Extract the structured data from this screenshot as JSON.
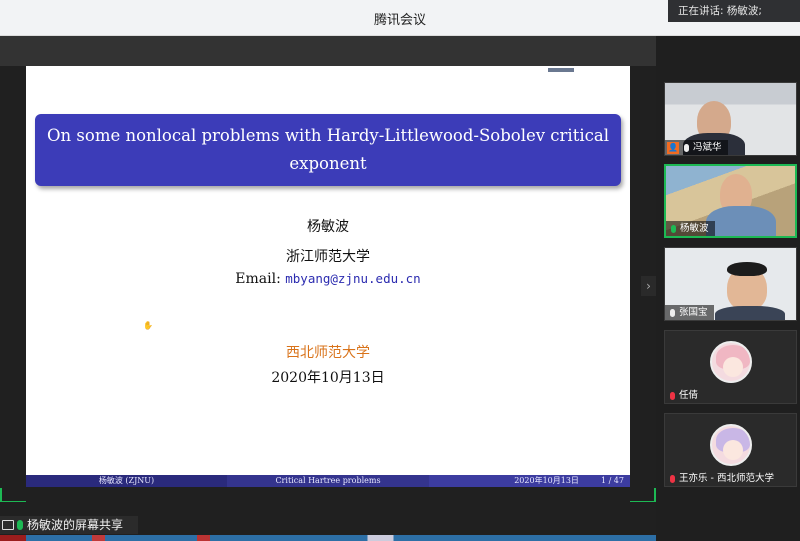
{
  "app": {
    "title": "腾讯会议",
    "speaking": "正在讲话: 杨敏波;"
  },
  "slide": {
    "title": "On some nonlocal problems with Hardy-Littlewood-Sobolev critical exponent",
    "author": "杨敏波",
    "affiliation": "浙江师范大学",
    "email_label": "Email: ",
    "email": "mbyang@zjnu.edu.cn",
    "host": "西北师范大学",
    "date": "2020年10月13日",
    "footer": {
      "left": "杨敏波 (ZJNU)",
      "center": "Critical Hartree problems",
      "date": "2020年10月13日",
      "page": "1 / 47"
    }
  },
  "share_label": "杨敏波的屏幕共享",
  "participants": [
    {
      "name": "冯斌华"
    },
    {
      "name": "杨敏波"
    },
    {
      "name": "张国宝"
    },
    {
      "name": "任倩"
    },
    {
      "name": "王亦乐 - 西北师范大学"
    }
  ]
}
